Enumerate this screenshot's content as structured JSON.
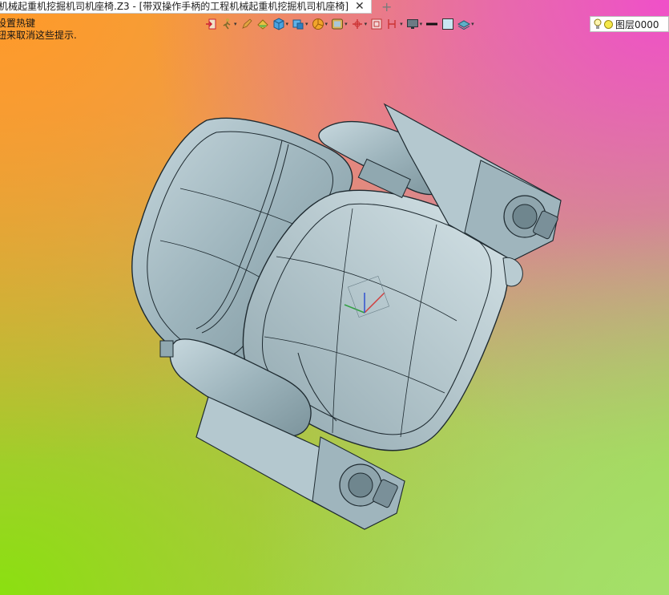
{
  "tabbar": {
    "active_tab_title": "机械起重机挖掘机司机座椅.Z3 - [带双操作手柄的工程机械起重机挖掘机司机座椅]",
    "close_glyph": "✕",
    "add_glyph": "+"
  },
  "hint": {
    "line1": "设置热键",
    "line2": "钮来取消这些提示."
  },
  "toolbar": {
    "icons": [
      "exit-icon",
      "walk-icon",
      "pencil-icon",
      "paint-bucket-icon",
      "cube-shaded-icon",
      "cube-view-icon",
      "pie-icon",
      "render-icon",
      "axis-icon",
      "frame-icon",
      "filter-icon",
      "monitor-icon",
      "line-weight-icon",
      "color-swatch-icon",
      "layer-stack-icon"
    ]
  },
  "layer_selector": {
    "value": "图层0000",
    "bulb_icon": "lightbulb-icon",
    "color_dot": "#f5e84a"
  },
  "viewport": {
    "model_color": "#a8c0c8",
    "model_edge_color": "#1e2a30"
  }
}
